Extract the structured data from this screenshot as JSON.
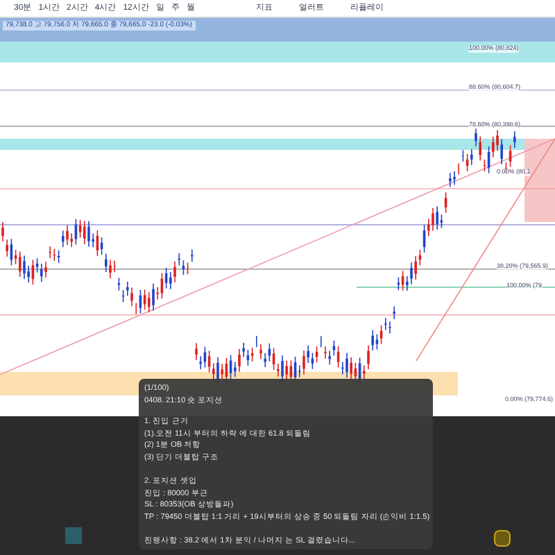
{
  "toolbar": {
    "timeframes": [
      {
        "label": "30분",
        "selected": false
      },
      {
        "label": "1시간",
        "selected": false
      },
      {
        "label": "2시간",
        "selected": false
      },
      {
        "label": "4시간",
        "selected": false
      },
      {
        "label": "12시간",
        "selected": false
      },
      {
        "label": "일",
        "selected": false
      },
      {
        "label": "주",
        "selected": false
      },
      {
        "label": "월",
        "selected": false
      }
    ],
    "tools": [
      "지표",
      "얼러트",
      "리플레이"
    ]
  },
  "ohlc": "79,738.0 고 79,756.0 저 79,665.0 종 79,665.0 -23.0 (-0.03%)",
  "fib_labels": [
    "100.00% (80,824)",
    "88.60% (80,604.7)",
    "78.60% (80,398.6)",
    "0.00% (80,1",
    "38.20% (79,565.9)",
    "100.00% (79",
    "0.00% (79,774.6)"
  ],
  "note": {
    "counter": "(1/100)",
    "title": "0408. 21:10 숏 포지션",
    "sections": [
      [
        "1. 진입 근거",
        "(1).오전 11시 부터의 하락 에 대한 61.8 되돌림",
        "(2) 1분 OB 저항",
        "(3) 단기 더블탑 구조"
      ],
      [
        "2. 포지션 셋업",
        "진입 : 80000 부근",
        "SL : 80353(OB 상방돌파)",
        "TP : 79450 더블탑 1:1 거리 + 19시부터의 상승 중 50 되돌림 자리 (손익비 1:1.5)"
      ],
      [
        "진행사항 : 38.2 에서 1차 분익 / 나머지 는 SL 걸렸습니다..."
      ]
    ]
  }
}
